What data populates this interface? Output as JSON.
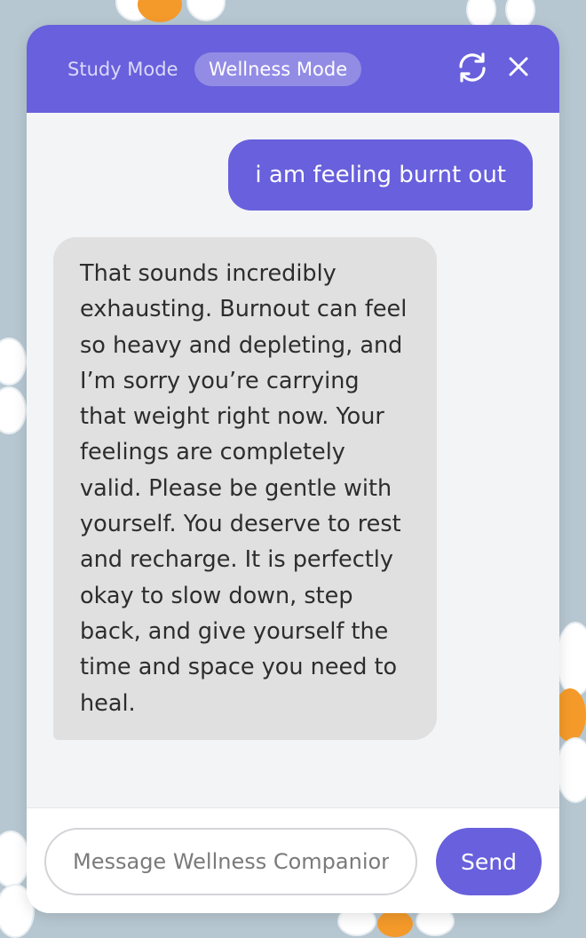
{
  "header": {
    "tabs": [
      {
        "label": "Study Mode",
        "active": false
      },
      {
        "label": "Wellness Mode",
        "active": true
      }
    ],
    "refresh_icon": "refresh-icon",
    "close_icon": "close-icon"
  },
  "messages": [
    {
      "role": "user",
      "text": "i am feeling burnt out"
    },
    {
      "role": "assistant",
      "text": "That sounds incredibly exhausting. Burnout can feel so heavy and depleting, and I’m sorry you’re carrying that weight right now. Your feelings are completely valid. Please be gentle with yourself. You deserve to rest and recharge. It is perfectly okay to slow down, step back, and give yourself the time and space you need to heal."
    }
  ],
  "composer": {
    "placeholder": "Message Wellness Companion...",
    "value": "",
    "send_label": "Send"
  },
  "colors": {
    "accent": "#6860dc",
    "background": "#b7c7d1",
    "bot_bubble": "#e0e0e0",
    "flower_center": "#f49a2a"
  }
}
